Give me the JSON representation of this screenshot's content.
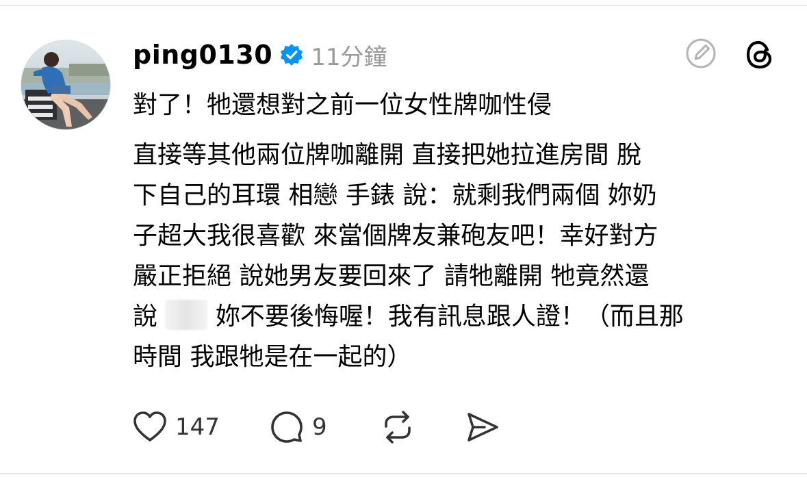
{
  "post": {
    "username": "ping0130",
    "timestamp": "11分鐘",
    "paragraph1": "對了！牠還想對之前一位女性牌咖性侵",
    "lines": [
      "直接等其他兩位牌咖離開 直接把她拉進房間 脫",
      "下自己的耳環 相戀 手錶 說：就剩我們兩個 妳奶",
      "子超大我很喜歡 來當個牌友兼砲友吧！幸好對方",
      "嚴正拒絕 說她男友要回來了 請牠離開 牠竟然還"
    ],
    "line6_prefix": "說",
    "line6_suffix": "妳不要後悔喔！我有訊息跟人證！（而且那",
    "line7": "時間 我跟牠是在一起的）"
  },
  "actions": {
    "like_count": "147",
    "reply_count": "9"
  },
  "icons": {
    "verified": "verified-badge-icon",
    "edit": "edit-icon",
    "threads": "threads-logo-icon",
    "like": "heart-icon",
    "reply": "comment-icon",
    "repost": "repost-icon",
    "share": "send-icon"
  },
  "colors": {
    "verified_blue": "#0095f6",
    "timestamp_gray": "#999999",
    "icon_gray": "#b3b3b3"
  }
}
